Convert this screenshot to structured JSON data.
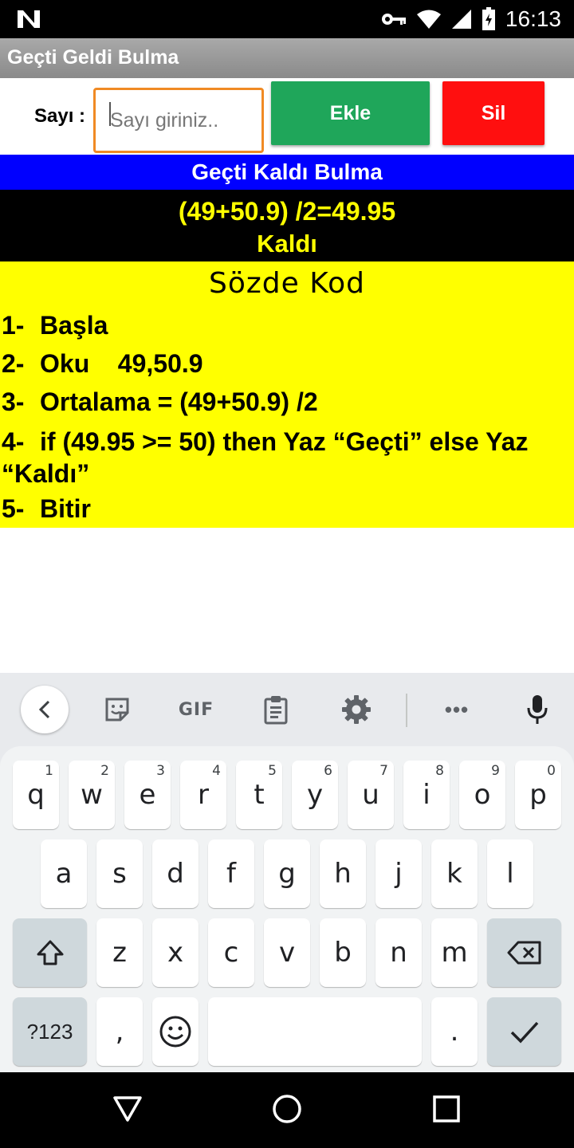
{
  "status_bar": {
    "time": "16:13",
    "icons": [
      "n-logo-icon",
      "key-icon",
      "wifi-icon",
      "signal-icon",
      "battery-icon"
    ]
  },
  "app_bar": {
    "title": "Geçti Geldi Bulma"
  },
  "form": {
    "sayi_label": "Sayı :",
    "input_placeholder": "Sayı giriniz..",
    "input_value": "",
    "add_button": "Ekle",
    "delete_button": "Sil"
  },
  "result": {
    "header": "Geçti Kaldı Bulma",
    "formula": "(49+50.9) /2=49.95",
    "verdict": "Kaldı"
  },
  "pseudocode": {
    "title": "Sözde  Kod",
    "lines": [
      {
        "num": "1-",
        "text": "Başla"
      },
      {
        "num": "2-",
        "text": "Oku    49,50.9"
      },
      {
        "num": "3-",
        "text": "Ortalama = (49+50.9) /2"
      },
      {
        "num": "4-",
        "text": "if (49.95 >= 50) then Yaz “Geçti” else Yaz “Kaldı”"
      },
      {
        "num": "5-",
        "text": "Bitir"
      }
    ]
  },
  "keyboard": {
    "toolbar": {
      "gif_label": "GIF",
      "more_label": "•••",
      "icons": [
        "back-arrow-icon",
        "sticker-icon",
        "gif-icon",
        "clipboard-icon",
        "settings-icon",
        "more-icon",
        "microphone-icon"
      ]
    },
    "row1": [
      {
        "key": "q",
        "hint": "1"
      },
      {
        "key": "w",
        "hint": "2"
      },
      {
        "key": "e",
        "hint": "3"
      },
      {
        "key": "r",
        "hint": "4"
      },
      {
        "key": "t",
        "hint": "5"
      },
      {
        "key": "y",
        "hint": "6"
      },
      {
        "key": "u",
        "hint": "7"
      },
      {
        "key": "i",
        "hint": "8"
      },
      {
        "key": "o",
        "hint": "9"
      },
      {
        "key": "p",
        "hint": "0"
      }
    ],
    "row2": [
      "a",
      "s",
      "d",
      "f",
      "g",
      "h",
      "j",
      "k",
      "l"
    ],
    "row3": [
      "z",
      "x",
      "c",
      "v",
      "b",
      "n",
      "m"
    ],
    "symbols_key": "?123",
    "comma_key": ",",
    "period_key": "."
  },
  "nav_bar": {
    "icons": [
      "back-triangle-icon",
      "home-circle-icon",
      "recents-square-icon"
    ]
  }
}
